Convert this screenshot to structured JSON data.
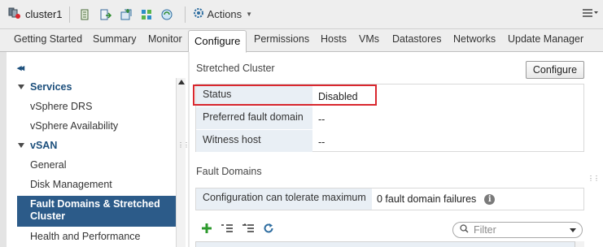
{
  "titlebar": {
    "host_name": "cluster1",
    "actions_label": "Actions",
    "icons": [
      "cluster-icon",
      "add-host-icon",
      "move-icon",
      "new-vm-icon",
      "new-vapp-icon",
      "resource-pool-icon",
      "deploy-ovf-icon"
    ]
  },
  "tabs": [
    "Getting Started",
    "Summary",
    "Monitor",
    "Configure",
    "Permissions",
    "Hosts",
    "VMs",
    "Datastores",
    "Networks",
    "Update Manager"
  ],
  "active_tab": "Configure",
  "nav": {
    "collapse_label": "◂◂",
    "services_label": "Services",
    "services_items": [
      "vSphere DRS",
      "vSphere Availability"
    ],
    "vsan_label": "vSAN",
    "vsan_items": [
      "General",
      "Disk Management",
      "Fault Domains & Stretched Cluster",
      "Health and Performance"
    ],
    "selected": "Fault Domains & Stretched Cluster"
  },
  "stretched": {
    "title": "Stretched Cluster",
    "configure_button": "Configure",
    "rows": [
      {
        "label": "Status",
        "value": "Disabled"
      },
      {
        "label": "Preferred fault domain",
        "value": "--"
      },
      {
        "label": "Witness host",
        "value": "--"
      }
    ]
  },
  "fault_domains": {
    "title": "Fault Domains",
    "tolerate_label": "Configuration can tolerate maximum",
    "tolerate_value": "0 fault domain failures"
  },
  "filter": {
    "placeholder": "Filter"
  },
  "colors": {
    "selected_nav": "#2c5b89",
    "highlight": "#d9272e",
    "label_bg": "#e9eff5",
    "link": "#1c4f7c"
  }
}
